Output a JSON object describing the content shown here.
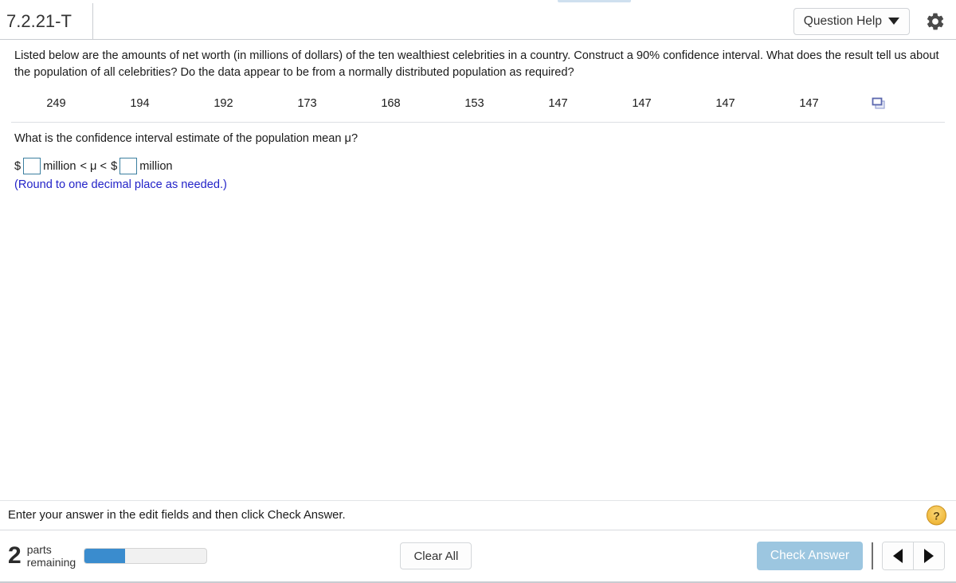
{
  "header": {
    "exercise_id": "7.2.21-T",
    "question_help_label": "Question Help",
    "caret_icon": "chevron-down-icon",
    "gear_icon": "gear-icon"
  },
  "question": {
    "text": "Listed below are the amounts of net worth (in millions of dollars) of the ten wealthiest celebrities in a country. Construct a 90% confidence interval. What does the result tell us about the population of all celebrities? Do the data appear to be from a normally distributed population as required?",
    "data_values": [
      "249",
      "194",
      "192",
      "173",
      "168",
      "153",
      "147",
      "147",
      "147",
      "147"
    ],
    "popup_icon": "open-data-popup-icon"
  },
  "answer": {
    "prompt": "What is the confidence interval estimate of the population mean μ?",
    "dollar_sign_left": "$",
    "million_left": "million",
    "inequality": "< μ <",
    "dollar_sign_right": "$",
    "million_right": "million",
    "input_left_value": "",
    "input_right_value": "",
    "input_placeholder": "",
    "round_note": "(Round to one decimal place as needed.)",
    "note_color": "#2323c8",
    "input_border_color": "#3b7fa0"
  },
  "instruction": {
    "text": "Enter your answer in the edit fields and then click Check Answer.",
    "help_icon_label": "?",
    "help_icon_name": "help-question-icon",
    "help_icon_color": "#f0b93d"
  },
  "footer": {
    "parts_count": "2",
    "parts_label_line1": "parts",
    "parts_label_line2": "remaining",
    "progress_percent": 33,
    "progress_fill_color": "#3a8cce",
    "clear_all_label": "Clear All",
    "check_answer_label": "Check Answer",
    "check_answer_color": "#9cc6e0",
    "prev_icon": "triangle-left-icon",
    "next_icon": "triangle-right-icon"
  }
}
